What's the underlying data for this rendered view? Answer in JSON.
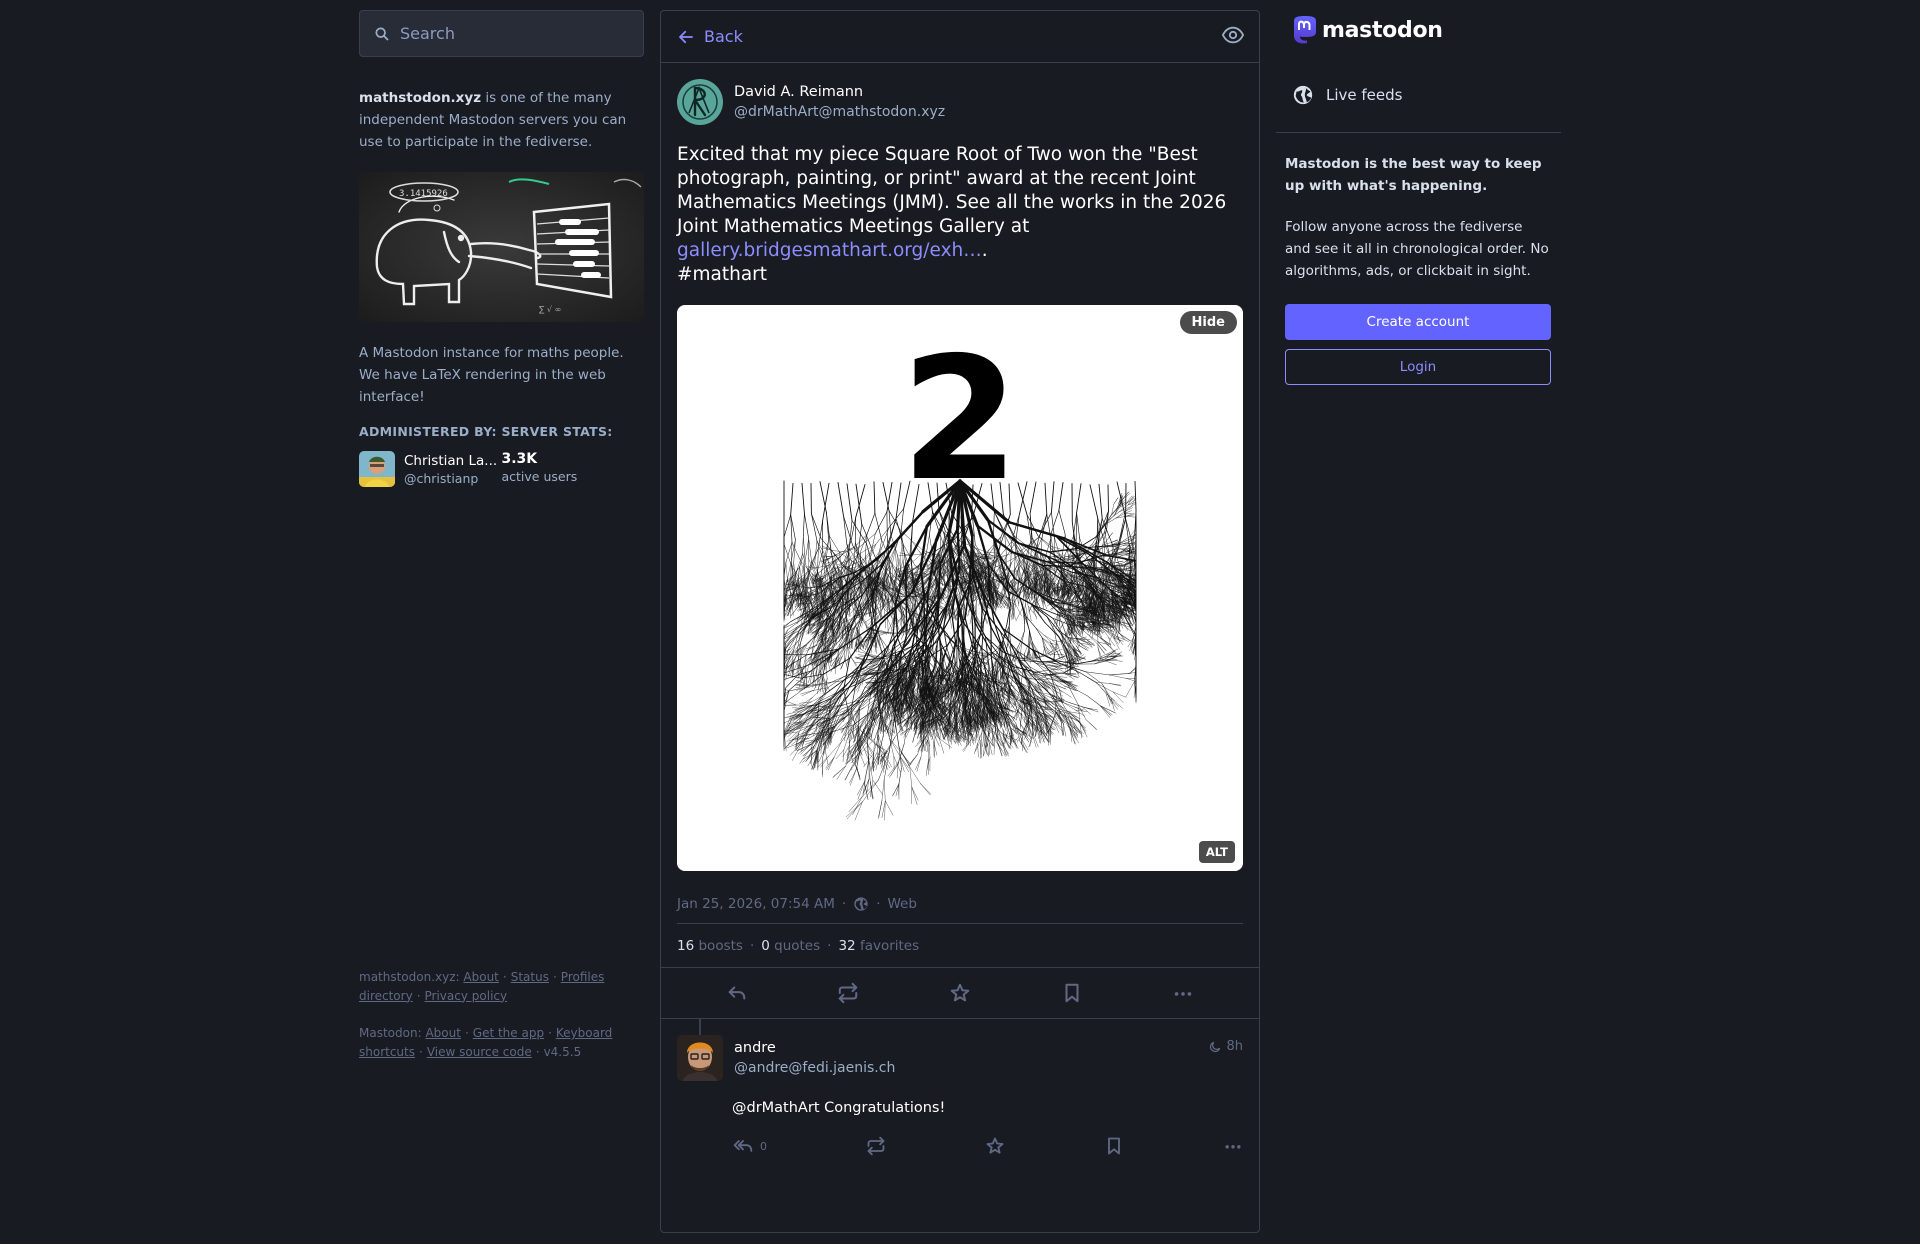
{
  "search": {
    "placeholder": "Search"
  },
  "server": {
    "domain": "mathstodon.xyz",
    "intro_rest": " is one of the many independent Mastodon servers you can use to participate in the fediverse.",
    "description": "A Mastodon instance for maths people. We have LaTeX rendering in the web interface!",
    "administered_by_label": "ADMINISTERED BY:",
    "server_stats_label": "SERVER STATS:",
    "admin_name": "Christian La...",
    "admin_handle": "@christianp",
    "active_users_value": "3.3K",
    "active_users_label": "active users"
  },
  "footer": {
    "server_prefix": "mathstodon.xyz:",
    "server_links": [
      "About",
      "Status",
      "Profiles directory",
      "Privacy policy"
    ],
    "mastodon_prefix": "Mastodon:",
    "mastodon_links": [
      "About",
      "Get the app",
      "Keyboard shortcuts",
      "View source code"
    ],
    "version": "v4.5.5"
  },
  "header": {
    "back_label": "Back"
  },
  "status": {
    "display_name": "David A. Reimann",
    "handle": "@drMathArt@mathstodon.xyz",
    "content_text": "Excited that my piece Square Root of Two won the \"Best photograph, painting, or print\" award at the recent Joint Mathematics Meetings (JMM). See all the works in the 2026 Joint Mathematics Meetings Gallery at ",
    "link_text": "gallery.bridgesmathart.org/exh…",
    "content_end": ".",
    "hashtag": "#mathart",
    "media_hide_label": "Hide",
    "media_alt_label": "ALT",
    "media_numeral": "2",
    "timestamp": "Jan 25, 2026, 07:54 AM",
    "dot": "·",
    "app": "Web",
    "boosts_count": "16",
    "boosts_label": "boosts",
    "quotes_count": "0",
    "quotes_label": "quotes",
    "favorites_count": "32",
    "favorites_label": "favorites"
  },
  "reply": {
    "display_name": "andre",
    "handle": "@andre@fedi.jaenis.ch",
    "time": "8h",
    "content": "@drMathArt Congratulations!",
    "reply_count": "0"
  },
  "sidebar": {
    "logo_text": "mastodon",
    "live_feeds_label": "Live feeds",
    "signup_heading": "Mastodon is the best way to keep up with what's happening.",
    "signup_body": "Follow anyone across the fediverse and see it all in chronological order. No algorithms, ads, or clickbait in sight.",
    "create_account_label": "Create account",
    "login_label": "Login"
  },
  "colors": {
    "accent": "#6364ff",
    "link": "#8c8dff",
    "background": "#191b22",
    "border": "#393f4f"
  }
}
